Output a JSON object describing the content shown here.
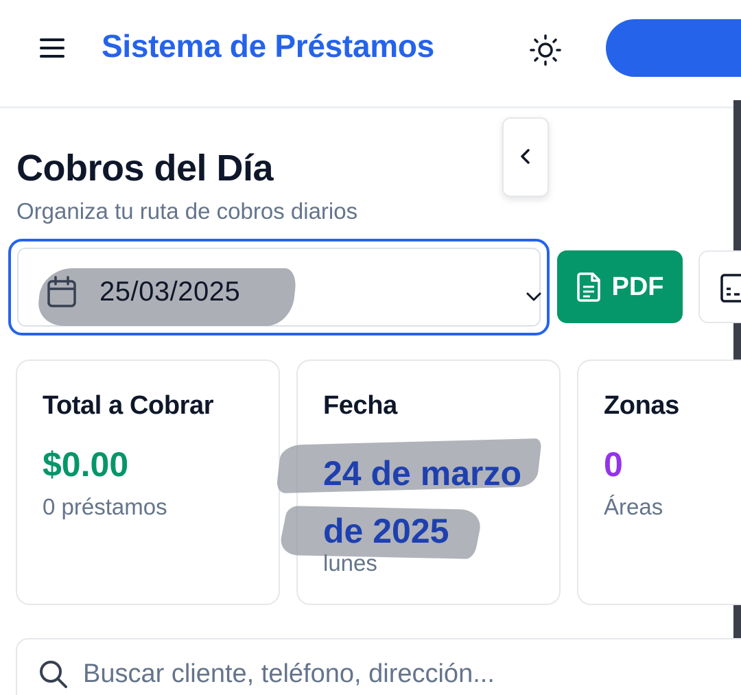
{
  "header": {
    "title": "Sistema de Préstamos",
    "menu_icon": "hamburger-menu-icon",
    "theme_icon": "sun-icon"
  },
  "page": {
    "title": "Cobros del Día",
    "subtitle": "Organiza tu ruta de cobros diarios"
  },
  "date_selector": {
    "value": "25/03/2025",
    "icon": "calendar-icon"
  },
  "actions": {
    "pdf_label": "PDF",
    "pdf_icon": "document-icon"
  },
  "stats": {
    "total": {
      "label": "Total a Cobrar",
      "value": "$0.00",
      "note": "0 préstamos"
    },
    "fecha": {
      "label": "Fecha",
      "value": "24 de marzo de 2025",
      "note": "lunes"
    },
    "zonas": {
      "label": "Zonas",
      "value": "0",
      "note": "Áreas"
    }
  },
  "search": {
    "placeholder": "Buscar cliente, teléfono, dirección..."
  },
  "colors": {
    "primary": "#2563eb",
    "success": "#059669",
    "accent_purple": "#9333ea",
    "date_blue": "#1e40af",
    "muted_text": "#64748b"
  }
}
